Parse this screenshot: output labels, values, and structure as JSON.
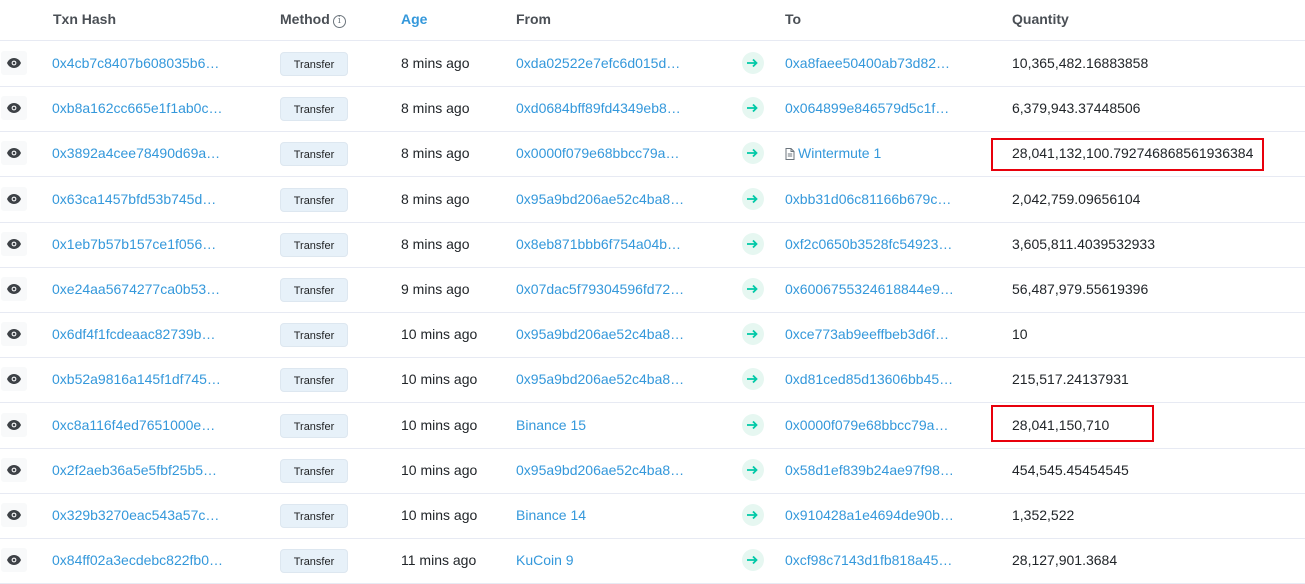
{
  "table": {
    "headers": {
      "hash": "Txn Hash",
      "method": "Method",
      "age": "Age",
      "from": "From",
      "to": "To",
      "quantity": "Quantity"
    },
    "rows": [
      {
        "hash": "0x4cb7c8407b608035b6…",
        "method": "Transfer",
        "age": "8 mins ago",
        "from": "0xda02522e7efc6d015d…",
        "to": "0xa8faee50400ab73d82…",
        "to_contract": false,
        "quantity": "10,365,482.16883858"
      },
      {
        "hash": "0xb8a162cc665e1f1ab0c…",
        "method": "Transfer",
        "age": "8 mins ago",
        "from": "0xd0684bff89fd4349eb8…",
        "to": "0x064899e846579d5c1f…",
        "to_contract": false,
        "quantity": "6,379,943.37448506"
      },
      {
        "hash": "0x3892a4cee78490d69a…",
        "method": "Transfer",
        "age": "8 mins ago",
        "from": "0x0000f079e68bbcc79a…",
        "to": "Wintermute 1",
        "to_contract": true,
        "quantity": "28,041,132,100.792746868561936384"
      },
      {
        "hash": "0x63ca1457bfd53b745d…",
        "method": "Transfer",
        "age": "8 mins ago",
        "from": "0x95a9bd206ae52c4ba8…",
        "to": "0xbb31d06c81166b679c…",
        "to_contract": false,
        "quantity": "2,042,759.09656104"
      },
      {
        "hash": "0x1eb7b57b157ce1f056…",
        "method": "Transfer",
        "age": "8 mins ago",
        "from": "0x8eb871bbb6f754a04b…",
        "to": "0xf2c0650b3528fc54923…",
        "to_contract": false,
        "quantity": "3,605,811.4039532933"
      },
      {
        "hash": "0xe24aa5674277ca0b53…",
        "method": "Transfer",
        "age": "9 mins ago",
        "from": "0x07dac5f79304596fd72…",
        "to": "0x6006755324618844e9…",
        "to_contract": false,
        "quantity": "56,487,979.55619396"
      },
      {
        "hash": "0x6df4f1fcdeaac82739b…",
        "method": "Transfer",
        "age": "10 mins ago",
        "from": "0x95a9bd206ae52c4ba8…",
        "to": "0xce773ab9eeffbeb3d6f…",
        "to_contract": false,
        "quantity": "10"
      },
      {
        "hash": "0xb52a9816a145f1df745…",
        "method": "Transfer",
        "age": "10 mins ago",
        "from": "0x95a9bd206ae52c4ba8…",
        "to": "0xd81ced85d13606bb45…",
        "to_contract": false,
        "quantity": "215,517.24137931"
      },
      {
        "hash": "0xc8a116f4ed7651000e…",
        "method": "Transfer",
        "age": "10 mins ago",
        "from": "Binance 15",
        "to": "0x0000f079e68bbcc79a…",
        "to_contract": false,
        "quantity": "28,041,150,710"
      },
      {
        "hash": "0x2f2aeb36a5e5fbf25b5…",
        "method": "Transfer",
        "age": "10 mins ago",
        "from": "0x95a9bd206ae52c4ba8…",
        "to": "0x58d1ef839b24ae97f98…",
        "to_contract": false,
        "quantity": "454,545.45454545"
      },
      {
        "hash": "0x329b3270eac543a57c…",
        "method": "Transfer",
        "age": "10 mins ago",
        "from": "Binance 14",
        "to": "0x910428a1e4694de90b…",
        "to_contract": false,
        "quantity": "1,352,522"
      },
      {
        "hash": "0x84ff02a3ecdebc822fb0…",
        "method": "Transfer",
        "age": "11 mins ago",
        "from": "KuCoin 9",
        "to": "0xcf98c7143d1fb818a45…",
        "to_contract": false,
        "quantity": "28,127,901.3684"
      }
    ]
  },
  "colors": {
    "link": "#3498db",
    "highlight_border": "#e8000c",
    "arrow_green": "#00c9a7"
  },
  "icons": {
    "row_preview": "eye-icon",
    "direction": "arrow-right-icon",
    "contract": "file-icon",
    "header_info": "info-icon"
  }
}
